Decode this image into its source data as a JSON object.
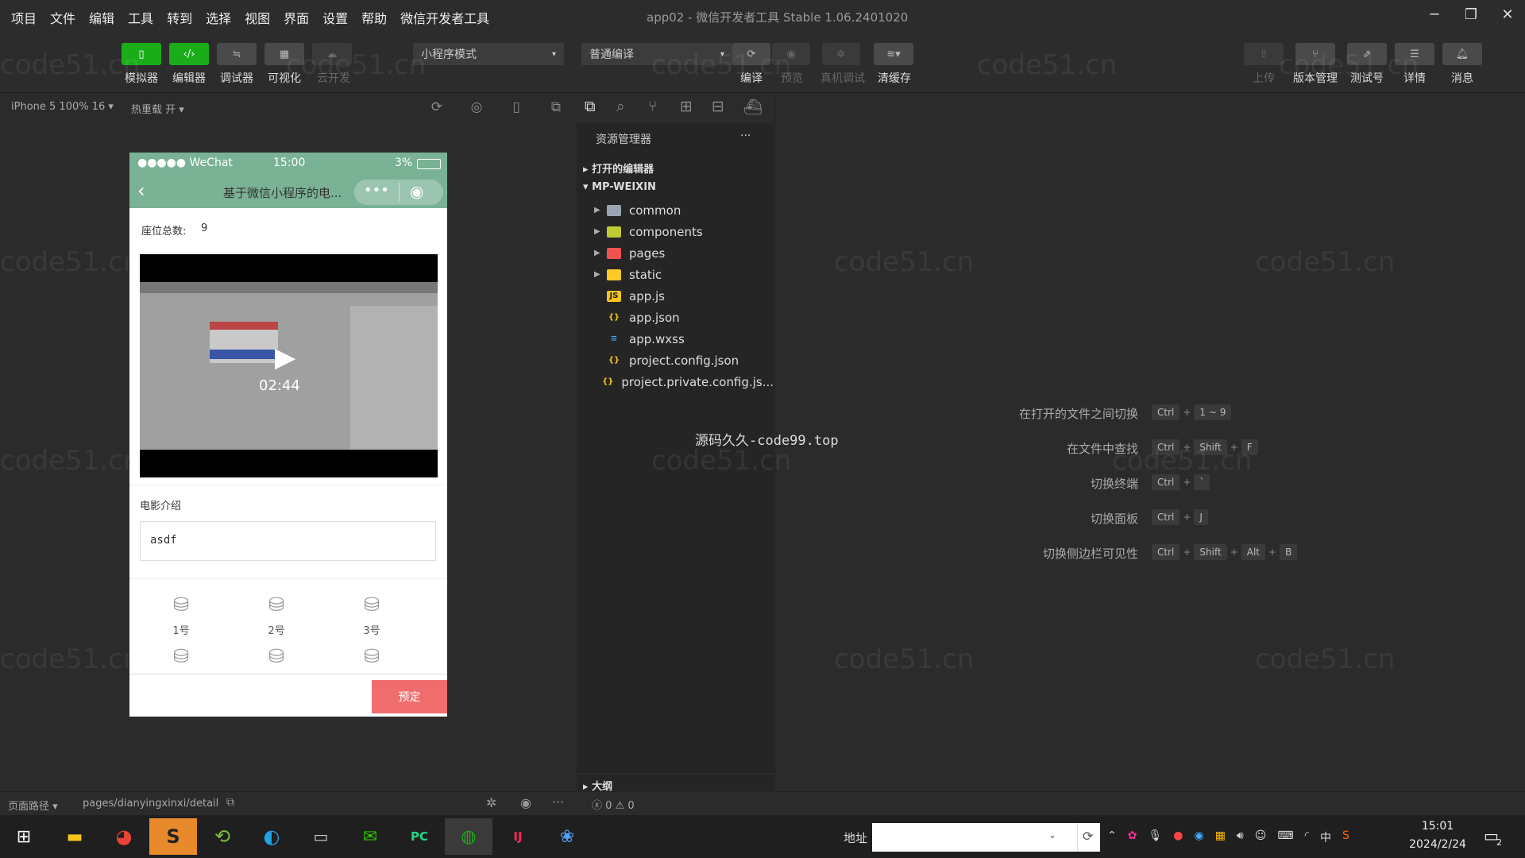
{
  "menubar": {
    "items": [
      "项目",
      "文件",
      "编辑",
      "工具",
      "转到",
      "选择",
      "视图",
      "界面",
      "设置",
      "帮助",
      "微信开发者工具"
    ],
    "title": "app02 - 微信开发者工具 Stable 1.06.2401020",
    "min_icon": "─",
    "restore_icon": "❐",
    "close_icon": "✕"
  },
  "toolbar": {
    "simulator": "模拟器",
    "editor": "编辑器",
    "debugger": "调试器",
    "visual": "可视化",
    "cloud": "云开发",
    "mode_select": "小程序模式",
    "compile_select": "普通编译",
    "compile": "编译",
    "preview": "预览",
    "remote_debug": "真机调试",
    "clear_cache": "清缓存",
    "upload": "上传",
    "version": "版本管理",
    "test": "测试号",
    "details": "详情",
    "messages": "消息"
  },
  "subbar": {
    "device": "iPhone 5 100% 16 ▾",
    "hotreload": "热重载 开 ▾"
  },
  "phone": {
    "carrier": "●●●●● WeChat",
    "time": "15:00",
    "battery": "3%",
    "page_title": "基于微信小程序的电...",
    "seat_total_label": "座位总数:",
    "seat_total_value": "9",
    "video_time": "02:44",
    "intro_label": "电影介绍",
    "intro_value": "asdf",
    "seats": [
      "1号",
      "2号",
      "3号"
    ],
    "reserve_button": "预定"
  },
  "explorer": {
    "title": "资源管理器",
    "more": "···",
    "open_editors": "打开的编辑器",
    "root": "MP-WEIXIN",
    "folders": [
      "common",
      "components",
      "pages",
      "static"
    ],
    "files": [
      "app.js",
      "app.json",
      "app.wxss",
      "project.config.json",
      "project.private.config.js..."
    ],
    "outline": "大纲",
    "errors": "0",
    "warnings": "0"
  },
  "editor": {
    "watermark_note": "源码久久-code99.top",
    "shortcuts": [
      {
        "label": "在打开的文件之间切换",
        "keys": [
          "Ctrl",
          "1 ~ 9"
        ]
      },
      {
        "label": "在文件中查找",
        "keys": [
          "Ctrl",
          "Shift",
          "F"
        ]
      },
      {
        "label": "切换终端",
        "keys": [
          "Ctrl",
          "`"
        ]
      },
      {
        "label": "切换面板",
        "keys": [
          "Ctrl",
          "J"
        ]
      },
      {
        "label": "切换侧边栏可见性",
        "keys": [
          "Ctrl",
          "Shift",
          "Alt",
          "B"
        ]
      }
    ]
  },
  "statusbottom": {
    "path_label": "页面路径 ▾",
    "path_value": "pages/dianyingxinxi/detail"
  },
  "taskbar": {
    "address_label": "地址",
    "ime": "中",
    "time": "15:01",
    "date": "2024/2/24",
    "notif": "2"
  },
  "watermark": "code51.cn",
  "colors": {
    "accent_green": "#1aad19",
    "nav_green": "#7ab296",
    "reserve_red": "#f06d6d"
  }
}
